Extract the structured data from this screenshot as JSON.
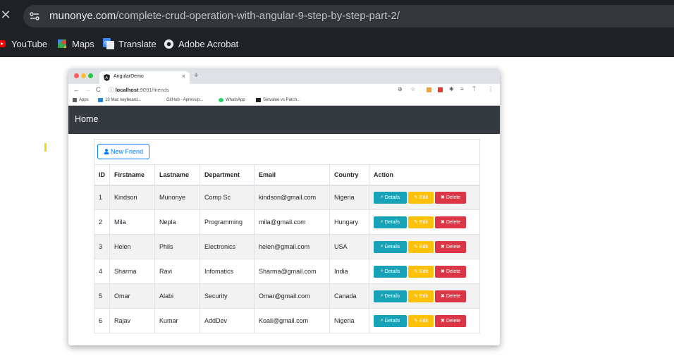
{
  "outer": {
    "url_domain": "munonye.com",
    "url_path": "/complete-crud-operation-with-angular-9-step-by-step-part-2/",
    "bookmarks": [
      {
        "label": "YouTube",
        "icon": "youtube-icon"
      },
      {
        "label": "Maps",
        "icon": "maps-icon"
      },
      {
        "label": "Translate",
        "icon": "translate-icon"
      },
      {
        "label": "Adobe Acrobat",
        "icon": "acrobat-icon"
      }
    ]
  },
  "inner": {
    "tab_title": "AngularDemo",
    "url_host": "localhost",
    "url_rest": ":9091/friends",
    "bookmarks": [
      {
        "label": "Apps"
      },
      {
        "label": "13 Mac keyboard..."
      },
      {
        "label": "GitHub - Apress/p..."
      },
      {
        "label": "WhatsApp"
      },
      {
        "label": "Setvalue vs Patch..."
      }
    ],
    "brand": "Home",
    "new_friend_label": "New Friend",
    "columns": [
      "ID",
      "Firstname",
      "Lastname",
      "Department",
      "Email",
      "Country",
      "Action"
    ],
    "rows": [
      {
        "id": "1",
        "first": "Kindson",
        "last": "Munonye",
        "dept": "Comp Sc",
        "email": "kindson@gmail.com",
        "country": "Nigeria"
      },
      {
        "id": "2",
        "first": "Mila",
        "last": "Nepla",
        "dept": "Programming",
        "email": "mila@gmail.com",
        "country": "Hungary"
      },
      {
        "id": "3",
        "first": "Helen",
        "last": "Phils",
        "dept": "Electronics",
        "email": "helen@gmail.com",
        "country": "USA"
      },
      {
        "id": "4",
        "first": "Sharma",
        "last": "Ravi",
        "dept": "Infomatics",
        "email": "Sharma@gmail.com",
        "country": "India"
      },
      {
        "id": "5",
        "first": "Omar",
        "last": "Alabi",
        "dept": "Security",
        "email": "Omar@gmail.com",
        "country": "Canada"
      },
      {
        "id": "6",
        "first": "Rajav",
        "last": "Kumar",
        "dept": "AddDev",
        "email": "Koali@gmail.com",
        "country": "Nigeria"
      }
    ],
    "action_labels": {
      "details": "Details",
      "edit": "Edit",
      "delete": "Delete"
    }
  },
  "colors": {
    "details": "#17a2b8",
    "edit": "#ffc107",
    "delete": "#dc3545",
    "primary": "#007bff",
    "navbar": "#343a40"
  }
}
